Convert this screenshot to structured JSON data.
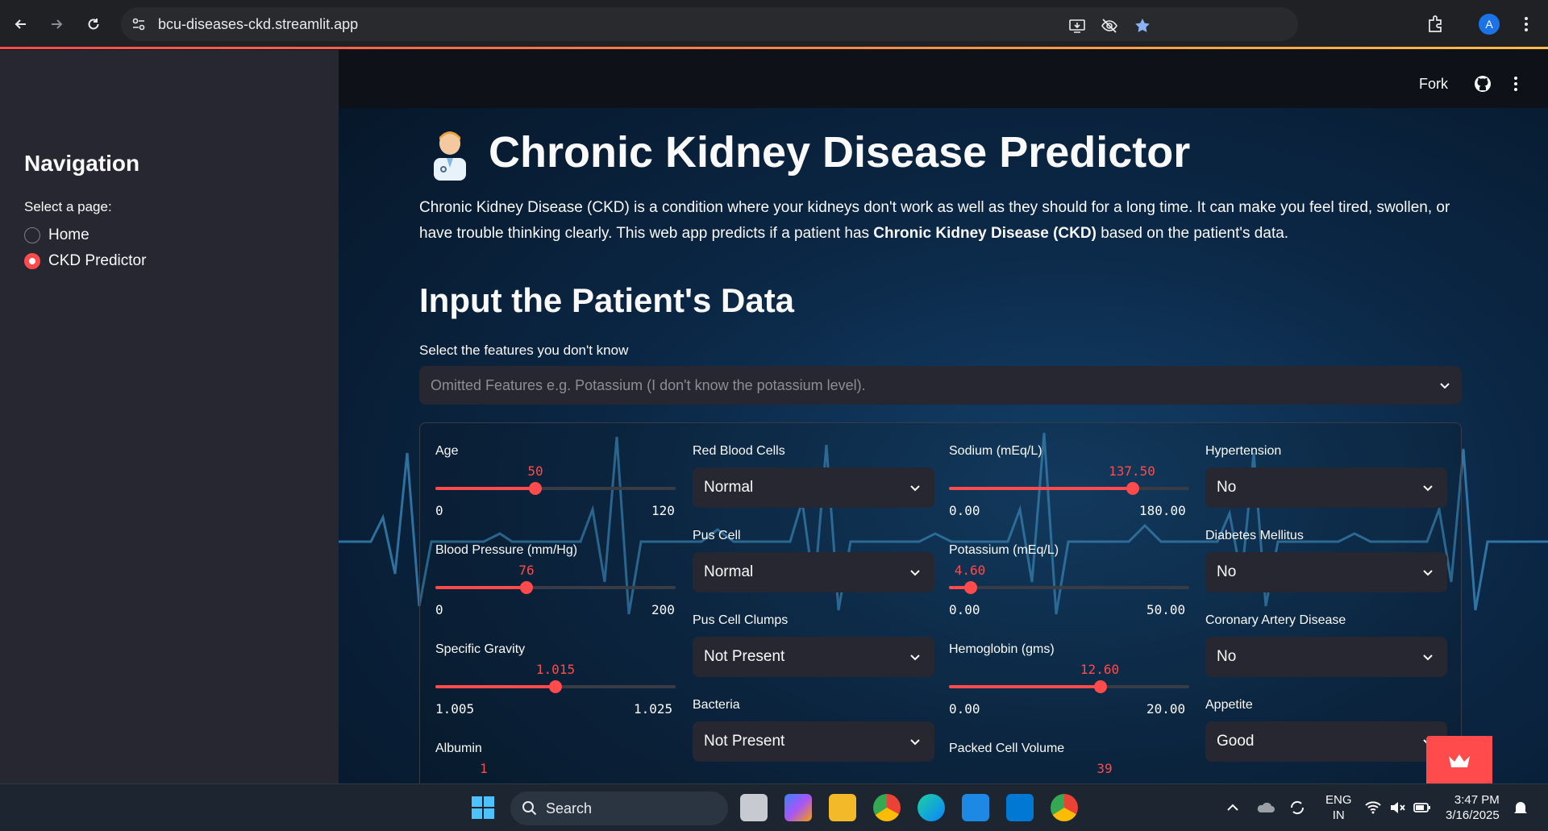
{
  "browser": {
    "url": "bcu-diseases-ckd.streamlit.app"
  },
  "sidebar": {
    "heading": "Navigation",
    "select_label": "Select a page:",
    "pages": [
      {
        "label": "Home",
        "selected": false
      },
      {
        "label": "CKD Predictor",
        "selected": true
      }
    ]
  },
  "header": {
    "fork_label": "Fork"
  },
  "main": {
    "title": "Chronic Kidney Disease Predictor",
    "title_emoji": "health-worker-icon",
    "intro_1": "Chronic Kidney Disease (CKD) is a condition where your kidneys don't work as well as they should for a long time. It can make you feel tired, swollen, or have trouble thinking clearly. This web app predicts if a patient has ",
    "intro_bold": "Chronic Kidney Disease (CKD)",
    "intro_2": " based on the patient's data.",
    "section_title": "Input the Patient's Data",
    "omit_label": "Select the features you don't know",
    "omit_placeholder": "Omitted Features e.g. Potassium (I don't know the potassium level).",
    "accent_color": "#ff4b4b"
  },
  "sliders": {
    "age": {
      "label": "Age",
      "value": "50",
      "min": "0",
      "max": "120",
      "fraction": 0.4167
    },
    "bp": {
      "label": "Blood Pressure (mm/Hg)",
      "value": "76",
      "min": "0",
      "max": "200",
      "fraction": 0.38
    },
    "sg": {
      "label": "Specific Gravity",
      "value": "1.015",
      "min": "1.005",
      "max": "1.025",
      "fraction": 0.5
    },
    "albumin": {
      "label": "Albumin",
      "value": "1"
    },
    "sodium": {
      "label": "Sodium (mEq/L)",
      "value": "137.50",
      "min": "0.00",
      "max": "180.00",
      "fraction": 0.7639
    },
    "potassium": {
      "label": "Potassium (mEq/L)",
      "value": "4.60",
      "min": "0.00",
      "max": "50.00",
      "fraction": 0.092
    },
    "hemoglobin": {
      "label": "Hemoglobin (gms)",
      "value": "12.60",
      "min": "0.00",
      "max": "20.00",
      "fraction": 0.63
    },
    "pcv": {
      "label": "Packed Cell Volume",
      "value": "39"
    }
  },
  "selects": {
    "rbc": {
      "label": "Red Blood Cells",
      "value": "Normal"
    },
    "pus_cell": {
      "label": "Pus Cell",
      "value": "Normal"
    },
    "pus_clumps": {
      "label": "Pus Cell Clumps",
      "value": "Not Present"
    },
    "bacteria": {
      "label": "Bacteria",
      "value": "Not Present"
    },
    "hypertension": {
      "label": "Hypertension",
      "value": "No"
    },
    "diabetes": {
      "label": "Diabetes Mellitus",
      "value": "No"
    },
    "cad": {
      "label": "Coronary Artery Disease",
      "value": "No"
    },
    "appetite": {
      "label": "Appetite",
      "value": "Good"
    }
  },
  "taskbar": {
    "search_label": "Search",
    "lang_1": "ENG",
    "lang_2": "IN",
    "time": "3:47 PM",
    "date": "3/16/2025"
  }
}
